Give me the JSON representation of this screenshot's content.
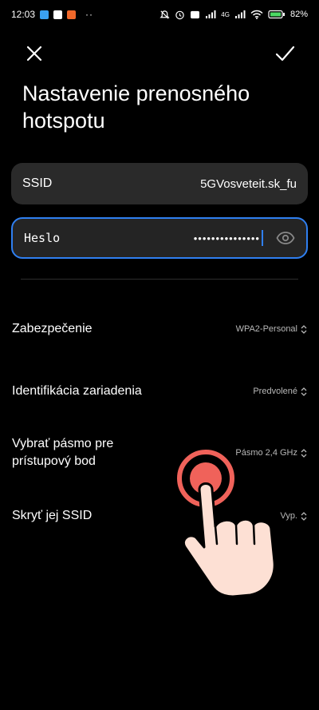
{
  "status": {
    "time": "12:03",
    "dots": "··",
    "network": "4G",
    "battery": "82%"
  },
  "title": "Nastavenie prenosného hotspotu",
  "ssid": {
    "label": "SSID",
    "value": "5GVosveteit.sk_fu"
  },
  "password": {
    "label": "Heslo",
    "masked": "•••••••••••••••"
  },
  "settings": [
    {
      "label": "Zabezpečenie",
      "value": "WPA2-Personal"
    },
    {
      "label": "Identifikácia zariadenia",
      "value": "Predvolené"
    },
    {
      "label": "Vybrať pásmo pre prístupový bod",
      "value": "Pásmo 2,4 GHz"
    },
    {
      "label": "Skryť jej SSID",
      "value": "Vyp."
    }
  ],
  "colors": {
    "accent": "#2f7ff0",
    "field_bg": "#2a2a2a",
    "tap_ring": "#f0625a"
  }
}
